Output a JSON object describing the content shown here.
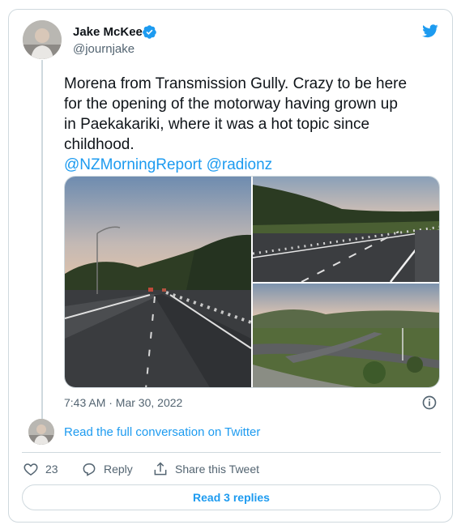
{
  "author": {
    "name": "Jake McKee",
    "handle": "@journjake",
    "verified": true
  },
  "tweet": {
    "text_lines": [
      "Morena from Transmission Gully. Crazy to be here",
      "for the opening of the motorway having grown up",
      "in Paekakariki, where it was a hot topic since",
      "childhood."
    ],
    "mentions": [
      "@NZMorningReport",
      "@radionz"
    ],
    "timestamp": "7:43 AM · Mar 30, 2022"
  },
  "links": {
    "read_conversation": "Read the full conversation on Twitter"
  },
  "actions": {
    "like_count": "23",
    "reply_label": "Reply",
    "share_label": "Share this Tweet"
  },
  "read_replies_label": "Read 3 replies",
  "colors": {
    "accent": "#1d9bf0",
    "text": "#0f1419",
    "muted": "#536471",
    "border": "#cfd9de"
  },
  "icons": {
    "logo": "twitter-bird-icon",
    "verified": "verified-badge-icon",
    "info": "info-icon",
    "like": "heart-icon",
    "reply": "reply-icon",
    "share": "share-icon"
  }
}
